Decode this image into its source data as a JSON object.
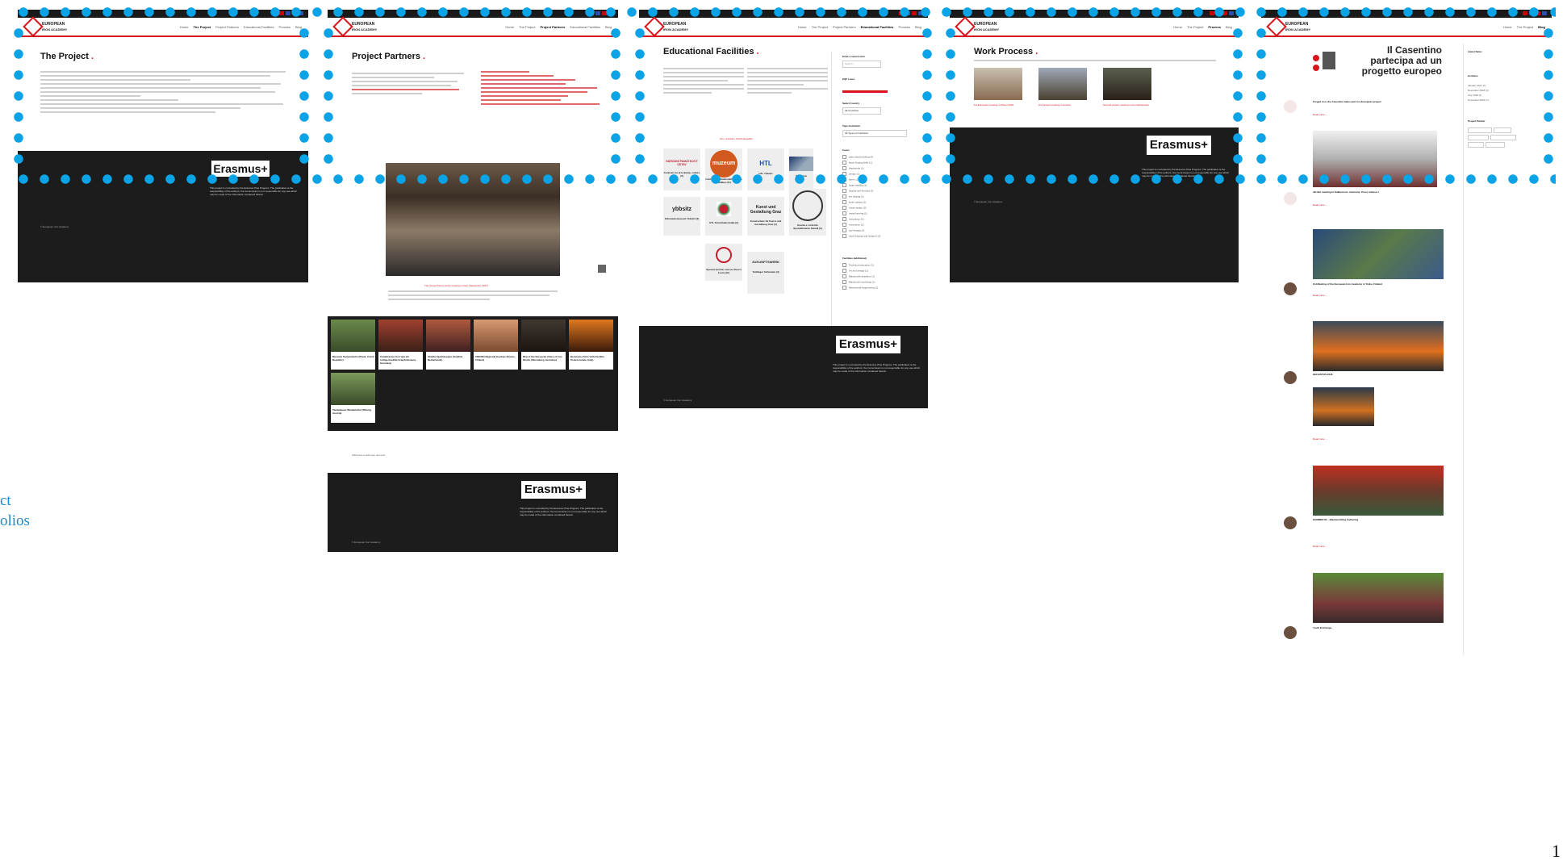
{
  "site": {
    "logo_line1": "EUROPEAN",
    "logo_line2": "IRON ACADEMY",
    "nav": [
      "Home",
      "The Project",
      "Project Partners",
      "Educational Facilities",
      "Process",
      "Blog",
      "Partner"
    ]
  },
  "pages": {
    "project": {
      "title": "The Project",
      "footer_copy": "© European Iron Academy"
    },
    "partners": {
      "title": "Project Partners",
      "photo_caption": "The Group Picture at the meeting in Italy (September 2017)",
      "cards": [
        "Museum Kamenitzeho (Pisek, Czech Republic)",
        "Canalizacion Iron tam (Ar cottigenoudfde Krie(Anderlecq, Germany)",
        "Abathu Hjelmdoppen (Amklob, Netherlands)",
        "VOKSIO Regional Gymnas (Kreise, Tirland)",
        "Rkp of the European Cities of Iron Works (Oberaburg, Germany)",
        "Bevenuto d'Ariz Voltoria (Sito Professionale, Italy)",
        "Tandelauser Windertotfel (Tilburg, Austria)"
      ],
      "footer_note": "Click here to add your own text",
      "footer_copy": "© European Iron Academy"
    },
    "facilities": {
      "title": "Educational Facilities",
      "nav_hint": "ALL • Austria • Czech Republic",
      "search_label": "Enter a search term",
      "search_placeholder": "Search ...",
      "eqf_label": "EQF Level",
      "country_label": "Select Country",
      "country_value": "All Countries",
      "institution_label": "Type Institution",
      "institution_value": "All Types of Institution",
      "focus_label": "Focus",
      "focus_items": [
        "artist blacksmithing (4)",
        "basic forging skills (1)",
        "blacksmith (1)",
        "design (1)",
        "farrier (1)",
        "forge welding (1)",
        "forging and forming (1)",
        "hot forging (1)",
        "knife making (1)",
        "metal design (2)",
        "metal forming (1)",
        "restoration (1)",
        "restoration (1)",
        "tool forging (1)",
        "tools (forging and chipper) (1)"
      ],
      "facilities_label": "Facilities (additional)",
      "facilities_items": [
        "Technical education (1)",
        "Art and design (1)",
        "Blacksmith academy (1)",
        "Blacksmith workshop (1)",
        "Mechanical engineering (1)"
      ],
      "logos": [
        "NÁRODNÍ PAMÁTKOVÝ ÚSTAV",
        "muzeum",
        "HTL",
        "∕",
        "ybbsitz",
        "Kunst und Gestaltung Graz",
        "ZUKUNFTSWERK",
        "Stadtmuseum Waidhofen"
      ],
      "logo_captions": [
        "Centrum for arts &amp; culture (3)",
        "Centrum for blacksmiths on the Sadlitea (11)",
        "HTL Ybbsitz",
        "Oberstolz",
        "Schmiedemuseum Ybbsitz (3)",
        "HTL Kirschtalerstraße (2)",
        "Kunstschule für Kunst und Gestaltung Graz (4)",
        "Scuola e controllo Spolubilmente Savelli (2)",
        "Special technic courses Kunst Form (12)",
        "Tuttlinger Schmiede (4)"
      ],
      "footer_copy": "© European Iron Academy"
    },
    "process": {
      "title": "Work Process",
      "captions": [
        "1st European meeting in Pilsen 2016",
        "2nd project meeting in Austria",
        "Second project meeting in the Netherlands"
      ],
      "footer_copy": "© European Iron Academy"
    },
    "blog": {
      "hero_line1": "Il Casentino",
      "hero_line2": "partecipa ad un",
      "hero_line3": "progetto europeo",
      "posts": [
        {
          "title": "Forged iron, the Casentino takes part in a European project",
          "more": "Read more →"
        },
        {
          "title": "4th EIA meeting in Kalbermoor, Germany: Press release 1",
          "more": "Read more →"
        },
        {
          "title": "3rd Meeting of the European Iron Academy in Turku, Finland",
          "more": "Read more →"
        },
        {
          "title": "HEFAISTOS 2018",
          "more": "Read more →"
        },
        {
          "title": "HAMMER IN – Blacksmithing Gathering",
          "more": "Read more →"
        },
        {
          "title": "Youth Exchange",
          "more": ""
        }
      ],
      "sidebar_latest": "Latest News",
      "sidebar_archives": "Archives",
      "archive_items": [
        "January 2017 (1)",
        "November 2018 (3)",
        "July 2018 (1)",
        "November 2019 (1)"
      ],
      "sidebar_partner": "Project Partner"
    }
  },
  "erasmus_label": "Erasmus+",
  "erasmus_text": "This project is co-funded by the Erasmus Plus Program. The publication is the responsibility of the authors; the Commission is not responsible for any use which may be made of the information contained therein.",
  "side_label_line1": "ct",
  "side_label_line2": "olios",
  "page_number": "1",
  "colors": {
    "accent": "#d8141c",
    "dots": "#0aa3e6",
    "footer": "#1c1c1c"
  }
}
